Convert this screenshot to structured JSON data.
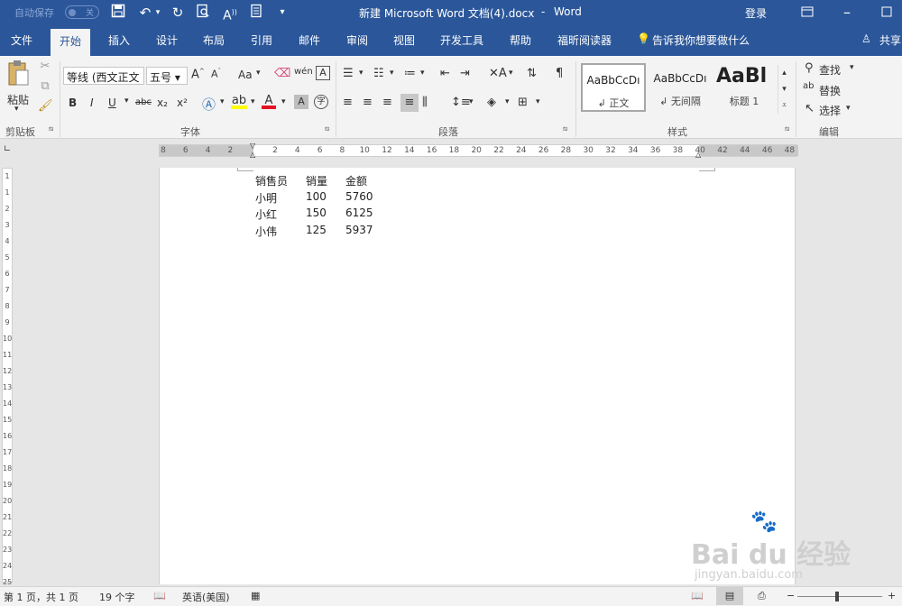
{
  "titlebar": {
    "autosave_label": "自动保存",
    "autosave_state": "关",
    "doc_title": "新建 Microsoft Word 文档(4).docx",
    "separator": "-",
    "app_name": "Word",
    "login_label": "登录",
    "bg_color": "#2b579a"
  },
  "tabs": [
    "文件",
    "开始",
    "插入",
    "设计",
    "布局",
    "引用",
    "邮件",
    "审阅",
    "视图",
    "开发工具",
    "帮助",
    "福昕阅读器"
  ],
  "active_tab": "开始",
  "tell_me": "告诉我你想要做什么",
  "share_label": "共享",
  "ribbon": {
    "clipboard": {
      "paste": "粘贴",
      "group": "剪贴板"
    },
    "font": {
      "font_name": "等线 (西文正文",
      "font_size": "五号",
      "case_label": "Aa",
      "bold": "B",
      "italic": "I",
      "underline": "U",
      "strike": "abc",
      "subscript": "x₂",
      "superscript": "x²",
      "phonetic": "wén",
      "group": "字体"
    },
    "paragraph": {
      "group": "段落"
    },
    "styles": {
      "items": [
        {
          "preview": "AaBbCcDı",
          "name": "↲ 正文"
        },
        {
          "preview": "AaBbCcDı",
          "name": "↲ 无间隔"
        },
        {
          "preview": "AaBl",
          "name": "标题 1"
        }
      ],
      "group": "样式"
    },
    "editing": {
      "find": "查找",
      "replace": "替换",
      "select": "选择",
      "group": "编辑"
    }
  },
  "hruler": {
    "ticks": [
      "8",
      "6",
      "4",
      "2",
      "",
      "2",
      "4",
      "6",
      "8",
      "10",
      "12",
      "14",
      "16",
      "18",
      "20",
      "22",
      "24",
      "26",
      "28",
      "30",
      "32",
      "34",
      "36",
      "38",
      "40",
      "42",
      "44",
      "46",
      "48"
    ]
  },
  "vruler": {
    "ticks": [
      "1",
      "1",
      "2",
      "3",
      "4",
      "5",
      "6",
      "7",
      "8",
      "9",
      "10",
      "11",
      "12",
      "13",
      "14",
      "15",
      "16",
      "17",
      "18",
      "19",
      "20",
      "21",
      "22",
      "23",
      "24",
      "25"
    ]
  },
  "document": {
    "table": {
      "headers": [
        "销售员",
        "销量",
        "金额"
      ],
      "rows": [
        [
          "小明",
          "100",
          "5760"
        ],
        [
          "小红",
          "150",
          "6125"
        ],
        [
          "小伟",
          "125",
          "5937"
        ]
      ]
    }
  },
  "status": {
    "page": "第 1 页，共 1 页",
    "words": "19 个字",
    "language": "英语(美国)",
    "zoom_minus": "−",
    "zoom_plus": "+"
  },
  "watermark": {
    "brand": "Bai du 经验",
    "url": "jingyan.baidu.com"
  }
}
